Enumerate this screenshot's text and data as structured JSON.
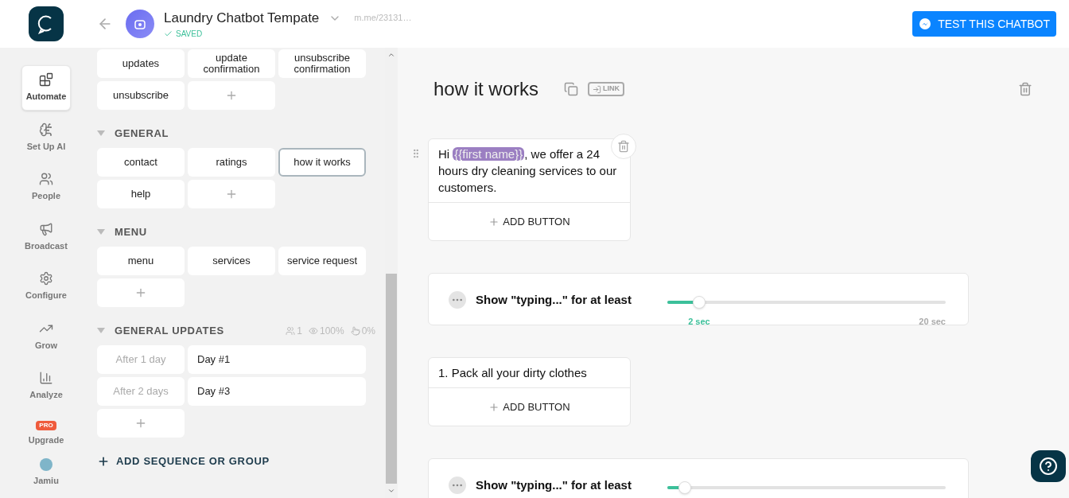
{
  "header": {
    "bot_name": "Laundry Chatbot Tempate",
    "status": "SAVED",
    "link": "m.me/23131…",
    "test_button": "TEST THIS CHATBOT"
  },
  "nav": [
    {
      "kind": "automate",
      "label": "Automate",
      "selected": true
    },
    {
      "kind": "ai",
      "label": "Set Up AI",
      "selected": false
    },
    {
      "kind": "people",
      "label": "People",
      "selected": false
    },
    {
      "kind": "broadcast",
      "label": "Broadcast",
      "selected": false
    },
    {
      "kind": "configure",
      "label": "Configure",
      "selected": false
    },
    {
      "kind": "grow",
      "label": "Grow",
      "selected": false
    },
    {
      "kind": "analyze",
      "label": "Analyze",
      "selected": false
    },
    {
      "kind": "upgrade",
      "label": "Upgrade",
      "badge": "PRO",
      "selected": false
    },
    {
      "kind": "user",
      "label": "Jamiu"
    }
  ],
  "top_blocks": [
    {
      "kind": "block",
      "label": "updates",
      "selected": false
    },
    {
      "kind": "block",
      "label": "update confirmation",
      "selected": false
    },
    {
      "kind": "block",
      "label": "unsubscribe confirmation",
      "selected": false
    },
    {
      "kind": "block",
      "label": "unsubscribe",
      "selected": false
    },
    {
      "kind": "add"
    }
  ],
  "groups": [
    {
      "title": "GENERAL",
      "expanded": true,
      "blocks": [
        {
          "kind": "block",
          "label": "contact",
          "selected": false
        },
        {
          "kind": "block",
          "label": "ratings",
          "selected": false
        },
        {
          "kind": "block",
          "label": "how it works",
          "selected": true
        },
        {
          "kind": "block",
          "label": "help",
          "selected": false
        },
        {
          "kind": "add"
        }
      ]
    },
    {
      "title": "MENU",
      "expanded": true,
      "blocks": [
        {
          "kind": "block",
          "label": "menu",
          "selected": false
        },
        {
          "kind": "block",
          "label": "services",
          "selected": false
        },
        {
          "kind": "block",
          "label": "service request",
          "selected": false
        },
        {
          "kind": "add"
        }
      ]
    },
    {
      "title": "GENERAL UPDATES",
      "expanded": true,
      "stats": [
        {
          "kind": "users",
          "text": "1"
        },
        {
          "kind": "views",
          "text": "100%"
        },
        {
          "kind": "clicks",
          "text": "0%"
        }
      ],
      "sequence": [
        {
          "delay": "After 1 day",
          "label": "Day #1"
        },
        {
          "delay": "After 2 days",
          "label": "Day #3"
        }
      ],
      "blocks": [
        {
          "kind": "add"
        }
      ]
    }
  ],
  "add_group": "ADD SEQUENCE OR GROUP",
  "flow": {
    "title": "how it works",
    "link_label": "LINK",
    "items": [
      {
        "kind": "text",
        "before": "Hi ",
        "variable": "{{first name}}",
        "after": ", we offer a 24 hours dry cleaning services to our customers.",
        "add_button": "ADD BUTTON"
      },
      {
        "kind": "typing",
        "label": "Show \"typing...\" for at least",
        "level": 0.114,
        "reading": "2 sec",
        "max": "20 sec"
      },
      {
        "kind": "text",
        "before": "1. Pack all your dirty clothes",
        "add_button": "ADD BUTTON"
      },
      {
        "kind": "typing",
        "label": "Show \"typing...\" for at least",
        "level": 0.063
      }
    ]
  }
}
